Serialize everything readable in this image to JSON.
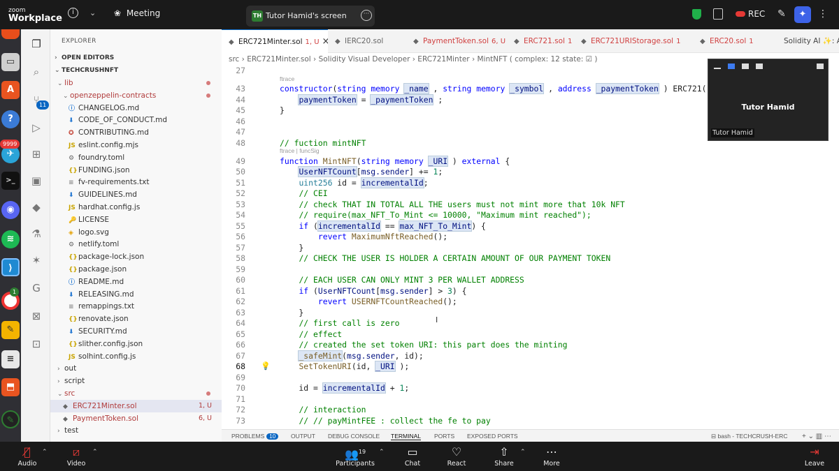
{
  "zoom": {
    "brand_small": "zoom",
    "brand": "Workplace",
    "meeting": "Meeting",
    "screen_tab_initials": "TH",
    "screen_tab": "Tutor Hamid's screen",
    "rec": "REC"
  },
  "explorer": {
    "title": "EXPLORER",
    "open_editors": "OPEN EDITORS",
    "project": "TECHCRUSHNFT",
    "rows": [
      {
        "label": "lib",
        "type": "folder",
        "open": true,
        "dot": true
      },
      {
        "label": "openzeppelin-contracts",
        "type": "folder",
        "open": true,
        "dot": true
      },
      {
        "label": "CHANGELOG.md",
        "type": "info"
      },
      {
        "label": "CODE_OF_CONDUCT.md",
        "type": "down"
      },
      {
        "label": "CONTRIBUTING.md",
        "type": "ribbon"
      },
      {
        "label": "eslint.config.mjs",
        "type": "js"
      },
      {
        "label": "foundry.toml",
        "type": "gear"
      },
      {
        "label": "FUNDING.json",
        "type": "json"
      },
      {
        "label": "fv-requirements.txt",
        "type": "txt"
      },
      {
        "label": "GUIDELINES.md",
        "type": "down"
      },
      {
        "label": "hardhat.config.js",
        "type": "js"
      },
      {
        "label": "LICENSE",
        "type": "key"
      },
      {
        "label": "logo.svg",
        "type": "svg"
      },
      {
        "label": "netlify.toml",
        "type": "gear"
      },
      {
        "label": "package-lock.json",
        "type": "json"
      },
      {
        "label": "package.json",
        "type": "json"
      },
      {
        "label": "README.md",
        "type": "info"
      },
      {
        "label": "RELEASING.md",
        "type": "down"
      },
      {
        "label": "remappings.txt",
        "type": "txt"
      },
      {
        "label": "renovate.json",
        "type": "json"
      },
      {
        "label": "SECURITY.md",
        "type": "down"
      },
      {
        "label": "slither.config.json",
        "type": "json"
      },
      {
        "label": "solhint.config.js",
        "type": "js"
      },
      {
        "label": "out",
        "type": "folder",
        "open": false
      },
      {
        "label": "script",
        "type": "folder",
        "open": false
      },
      {
        "label": "src",
        "type": "folder",
        "open": true,
        "dot": true
      },
      {
        "label": "ERC721Minter.sol",
        "type": "sol",
        "status": "1, U",
        "selected": true
      },
      {
        "label": "PaymentToken.sol",
        "type": "sol",
        "status": "6, U"
      },
      {
        "label": "test",
        "type": "folder",
        "open": false
      }
    ]
  },
  "tabs": [
    {
      "label": "ERC721Minter.sol",
      "status": "1, U",
      "active": true
    },
    {
      "label": "IERC20.sol",
      "status": ""
    },
    {
      "label": "PaymentToken.sol",
      "status": "6, U"
    },
    {
      "label": "ERC721.sol",
      "status": "1"
    },
    {
      "label": "ERC721URIStorage.sol",
      "status": "1"
    },
    {
      "label": "ERC20.sol",
      "status": "1"
    },
    {
      "label": "Solidity AI ✨: Assista",
      "status": ""
    }
  ],
  "breadcrumb": "src  ›  ERC721Minter.sol  ›  Solidity Visual Developer  ›  ERC721Minter  ›  MintNFT  ( complex: 12 state: ☑ )",
  "code_lines": [
    {
      "n": "27",
      "tokens": []
    },
    {
      "hint": "ftrace"
    },
    {
      "n": "43",
      "tokens": [
        [
          "k",
          "constructor"
        ],
        [
          "p",
          "("
        ],
        [
          "k",
          "string"
        ],
        [
          "p",
          " "
        ],
        [
          "k",
          "memory"
        ],
        [
          "p",
          " "
        ],
        [
          "vh",
          "_name"
        ],
        [
          "p",
          " , "
        ],
        [
          "k",
          "string"
        ],
        [
          "p",
          " "
        ],
        [
          "k",
          "memory"
        ],
        [
          "p",
          " "
        ],
        [
          "vh",
          "_symbol"
        ],
        [
          "p",
          " , "
        ],
        [
          "k",
          "address"
        ],
        [
          "p",
          " "
        ],
        [
          "vh",
          "_paymentToken"
        ],
        [
          "p",
          " ) ERC721("
        ]
      ]
    },
    {
      "n": "44",
      "tokens": [
        [
          "p",
          "    "
        ],
        [
          "vh",
          "paymentToken"
        ],
        [
          "p",
          " = "
        ],
        [
          "vh",
          "_paymentToken"
        ],
        [
          "p",
          " ;"
        ]
      ]
    },
    {
      "n": "45",
      "tokens": [
        [
          "p",
          "}"
        ]
      ]
    },
    {
      "n": "46",
      "tokens": []
    },
    {
      "n": "47",
      "tokens": []
    },
    {
      "n": "48",
      "tokens": [
        [
          "c",
          "// fuction mintNFT"
        ]
      ]
    },
    {
      "hint": "ftrace | funcSig"
    },
    {
      "n": "49",
      "tokens": [
        [
          "k",
          "function"
        ],
        [
          "p",
          " "
        ],
        [
          "f",
          "MintNFT"
        ],
        [
          "p",
          "("
        ],
        [
          "k",
          "string"
        ],
        [
          "p",
          " "
        ],
        [
          "k",
          "memory"
        ],
        [
          "p",
          " "
        ],
        [
          "hl",
          "_URI"
        ],
        [
          "p",
          " ) "
        ],
        [
          "k",
          "external"
        ],
        [
          "p",
          " {"
        ]
      ]
    },
    {
      "n": "50",
      "tokens": [
        [
          "p",
          "    "
        ],
        [
          "vh",
          "UserNFTCount"
        ],
        [
          "p",
          "["
        ],
        [
          "v",
          "msg.sender"
        ],
        [
          "p",
          "] += "
        ],
        [
          "n",
          "1"
        ],
        [
          "p",
          ";"
        ]
      ]
    },
    {
      "n": "51",
      "tokens": [
        [
          "p",
          "    "
        ],
        [
          "t",
          "uint256"
        ],
        [
          "p",
          " id = "
        ],
        [
          "vh",
          "incrementalId"
        ],
        [
          "p",
          ";"
        ]
      ]
    },
    {
      "n": "52",
      "tokens": [
        [
          "p",
          "    "
        ],
        [
          "c",
          "// CEI"
        ]
      ]
    },
    {
      "n": "53",
      "tokens": [
        [
          "p",
          "    "
        ],
        [
          "c",
          "// check THAT IN TOTAL ALL THE users must not mint more that 10k NFT"
        ]
      ]
    },
    {
      "n": "54",
      "tokens": [
        [
          "p",
          "    "
        ],
        [
          "c",
          "// require(max_NFT_To_Mint <= 10000, \"Maximum mint reached\");"
        ]
      ]
    },
    {
      "n": "55",
      "tokens": [
        [
          "p",
          "    "
        ],
        [
          "k",
          "if"
        ],
        [
          "p",
          " ("
        ],
        [
          "vh",
          "incrementalId"
        ],
        [
          "p",
          " == "
        ],
        [
          "vh",
          "max_NFT_To_Mint"
        ],
        [
          "p",
          ") {"
        ]
      ]
    },
    {
      "n": "56",
      "tokens": [
        [
          "p",
          "        "
        ],
        [
          "k",
          "revert"
        ],
        [
          "p",
          " "
        ],
        [
          "f",
          "MaximumNftReached"
        ],
        [
          "p",
          "();"
        ]
      ]
    },
    {
      "n": "57",
      "tokens": [
        [
          "p",
          "    }"
        ]
      ]
    },
    {
      "n": "58",
      "tokens": [
        [
          "p",
          "    "
        ],
        [
          "c",
          "// CHECK THE USER IS HOLDER A CERTAIN AMOUNT OF OUR PAYMENT TOKEN"
        ]
      ]
    },
    {
      "n": "59",
      "tokens": []
    },
    {
      "n": "60",
      "tokens": [
        [
          "p",
          "    "
        ],
        [
          "c",
          "// EACH USER CAN ONLY MINT 3 PER WALLET ADDRESS"
        ]
      ]
    },
    {
      "n": "61",
      "tokens": [
        [
          "p",
          "    "
        ],
        [
          "k",
          "if"
        ],
        [
          "p",
          " ("
        ],
        [
          "v",
          "UserNFTCount"
        ],
        [
          "p",
          "["
        ],
        [
          "v",
          "msg.sender"
        ],
        [
          "p",
          "] > "
        ],
        [
          "n",
          "3"
        ],
        [
          "p",
          ") {"
        ]
      ]
    },
    {
      "n": "62",
      "tokens": [
        [
          "p",
          "        "
        ],
        [
          "k",
          "revert"
        ],
        [
          "p",
          " "
        ],
        [
          "f",
          "USERNFTCountReached"
        ],
        [
          "p",
          "();"
        ]
      ]
    },
    {
      "n": "63",
      "tokens": [
        [
          "p",
          "    }"
        ]
      ]
    },
    {
      "n": "64",
      "tokens": [
        [
          "p",
          "    "
        ],
        [
          "c",
          "// first call is zero"
        ]
      ]
    },
    {
      "n": "65",
      "tokens": [
        [
          "p",
          "    "
        ],
        [
          "c",
          "// effect"
        ]
      ]
    },
    {
      "n": "66",
      "tokens": [
        [
          "p",
          "    "
        ],
        [
          "c",
          "// created the set token URI: this part does the minting"
        ]
      ]
    },
    {
      "n": "67",
      "tokens": [
        [
          "p",
          "    "
        ],
        [
          "fh",
          "_safeMint"
        ],
        [
          "p",
          "("
        ],
        [
          "v",
          "msg.sender"
        ],
        [
          "p",
          ", id);"
        ]
      ]
    },
    {
      "n": "68",
      "tokens": [
        [
          "p",
          "    "
        ],
        [
          "f",
          "SetTokenURI"
        ],
        [
          "p",
          "(id, "
        ],
        [
          "hl",
          "_URI"
        ],
        [
          "p",
          " );"
        ]
      ],
      "current": true
    },
    {
      "n": "69",
      "tokens": []
    },
    {
      "n": "70",
      "tokens": [
        [
          "p",
          "    id = "
        ],
        [
          "vh",
          "incrementalId"
        ],
        [
          "p",
          " + "
        ],
        [
          "n",
          "1"
        ],
        [
          "p",
          ";"
        ]
      ]
    },
    {
      "n": "71",
      "tokens": []
    },
    {
      "n": "72",
      "tokens": [
        [
          "p",
          "    "
        ],
        [
          "c",
          "// interaction"
        ]
      ]
    },
    {
      "n": "73",
      "tokens": [
        [
          "p",
          "    "
        ],
        [
          "c",
          "// // payMintFEE : collect the fe to pay"
        ]
      ]
    }
  ],
  "panel": {
    "problems": "PROBLEMS",
    "problems_count": "10",
    "output": "OUTPUT",
    "debug": "DEBUG CONSOLE",
    "terminal": "TERMINAL",
    "ports": "PORTS",
    "exposed": "EXPOSED PORTS",
    "shell": "bash - TECHCRUSH-ERC"
  },
  "video_thumb": {
    "name": "Tutor Hamid",
    "label": "Tutor Hamid"
  },
  "controls": {
    "audio": "Audio",
    "video": "Video",
    "participants": "Participants",
    "participants_count": "19",
    "chat": "Chat",
    "react": "React",
    "share": "Share",
    "more": "More",
    "leave": "Leave"
  },
  "dock_badges": {
    "vscode_count": "11",
    "telegram_count": "9999",
    "chrome_count": "1"
  },
  "colors": {
    "accent": "#0a66c2",
    "keyword": "#0000ff",
    "comment": "#008000",
    "function": "#795e26",
    "number": "#098658",
    "variable": "#001080",
    "rec": "#e53935"
  }
}
